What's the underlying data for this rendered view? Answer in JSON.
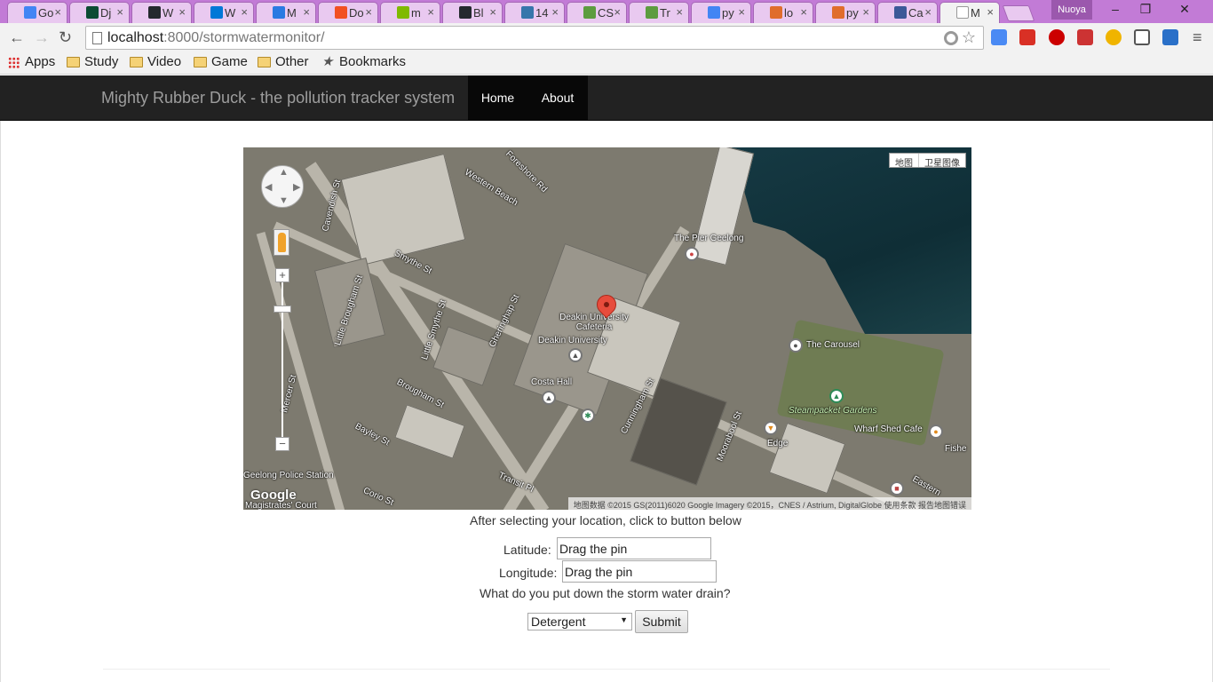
{
  "browser": {
    "tabs": [
      {
        "label": "Go",
        "fav": "#4285f4"
      },
      {
        "label": "Dj",
        "fav": "#0c4b33"
      },
      {
        "label": "W",
        "fav": "#24292e"
      },
      {
        "label": "W",
        "fav": "#0078d7"
      },
      {
        "label": "M",
        "fav": "#2a7ae2"
      },
      {
        "label": "Do",
        "fav": "#f25022"
      },
      {
        "label": "m",
        "fav": "#7fba00"
      },
      {
        "label": "Bl",
        "fav": "#24292e"
      },
      {
        "label": "14",
        "fav": "#3776ab"
      },
      {
        "label": "CS",
        "fav": "#5c9c3f"
      },
      {
        "label": "Tr",
        "fav": "#5c9c3f"
      },
      {
        "label": "py",
        "fav": "#4285f4"
      },
      {
        "label": "lo",
        "fav": "#e06d2c"
      },
      {
        "label": "py",
        "fav": "#e06d2c"
      },
      {
        "label": "Ca",
        "fav": "#3b5998"
      },
      {
        "label": "M",
        "fav": "#ffffff"
      }
    ],
    "profile_name": "Nuoya",
    "window_controls": {
      "minimize": "‒",
      "maximize": "❐",
      "close": "✕"
    },
    "url_host": "localhost",
    "url_path": ":8000/stormwatermonitor/",
    "bookmarks": {
      "apps": "Apps",
      "study": "Study",
      "video": "Video",
      "game": "Game",
      "other": "Other",
      "bookmarks": "Bookmarks"
    }
  },
  "site": {
    "brand": "Mighty Rubber Duck - the pollution tracker system",
    "nav": {
      "home": "Home",
      "about": "About"
    }
  },
  "map": {
    "type_buttons": {
      "map": "地图",
      "satellite": "卫星图像"
    },
    "labels": {
      "western_beach": "Western Beach",
      "foreshore": "Foreshore Rd",
      "cavendish": "Cavendish St",
      "smythe": "Smythe St",
      "little_brougham": "Little Brougham St",
      "little_smythe": "Little Smythe St",
      "brougham": "Brougham St",
      "mercer": "Mercer St",
      "bayley": "Bayley St",
      "gheringhap": "Gheringhap St",
      "cunningham": "Cunningham St",
      "moorabool": "Moorabool St",
      "pier": "The Pier Geelong",
      "cafeteria": "Deakin University Cafeteria",
      "deakin": "Deakin University",
      "costa": "Costa Hall",
      "carousel": "The Carousel",
      "steampacket": "Steampacket Gardens",
      "wharf": "Wharf Shed Cafe",
      "edge": "Edge",
      "police": "Geelong Police Station",
      "court": "Magistrates' Court",
      "corio": "Corio St",
      "fisher": "Fishe",
      "eastern": "Eastern",
      "transit": "Transit Pl"
    },
    "google": "Google",
    "attribution": "地图数据 ©2015 GS(2011)6020 Google Imagery ©2015，CNES / Astrium, DigitalGlobe    使用条款    报告地图错误"
  },
  "form": {
    "instruction": "After selecting your location, click to button below",
    "latitude_label": "Latitude:",
    "latitude_value": "Drag the pin",
    "longitude_label": "Longitude:",
    "longitude_value": "Drag the pin",
    "question": "What do you put down the storm water drain?",
    "selected_option": "Detergent",
    "submit_label": "Submit"
  }
}
